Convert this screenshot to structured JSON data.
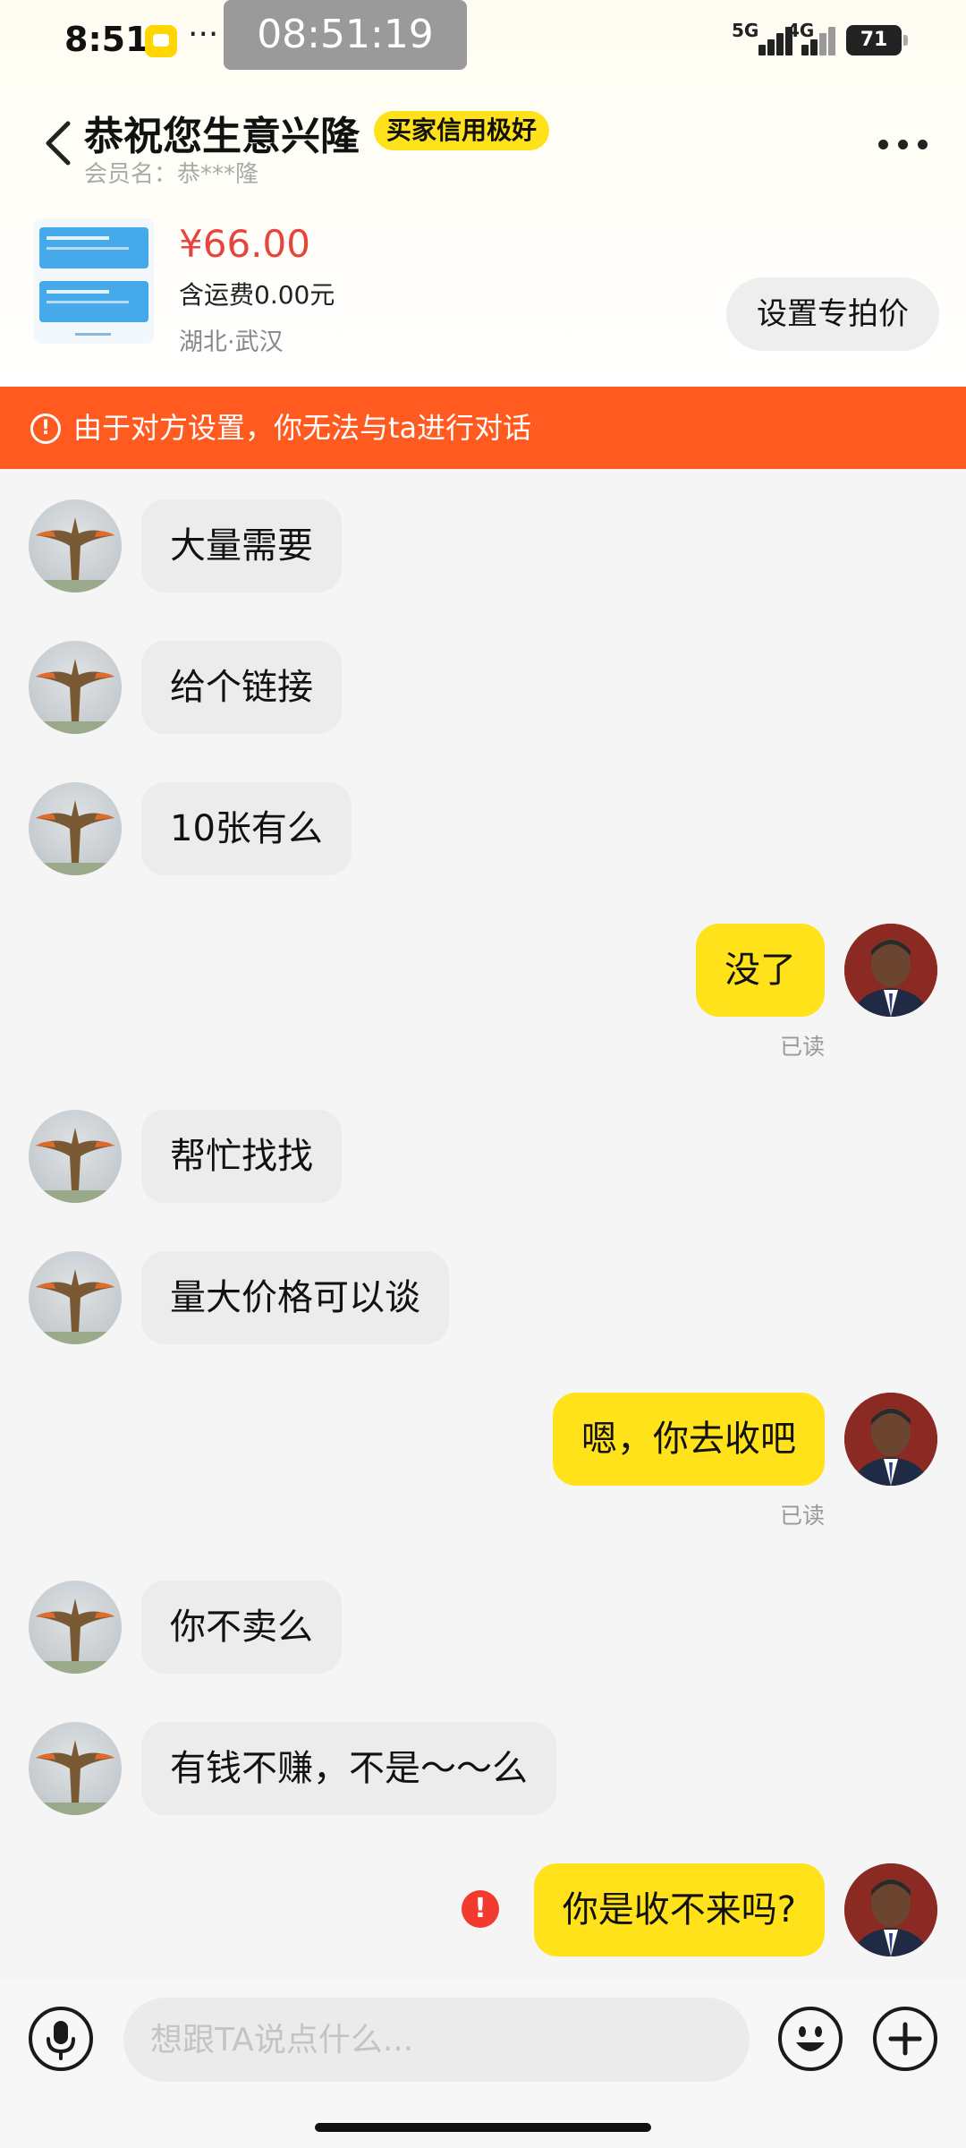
{
  "status_bar": {
    "time": "8:51",
    "dots": "···",
    "clock": "08:51:19",
    "net1": "5G",
    "net2": "4G",
    "battery": "71"
  },
  "header": {
    "title": "恭祝您生意兴隆",
    "badge": "买家信用极好",
    "member_name": "会员名：恭***隆"
  },
  "product": {
    "price": "¥66.00",
    "shipping": "含运费0.00元",
    "location": "湖北·武汉",
    "special_price_button": "设置专拍价"
  },
  "banner": {
    "warning_text": "由于对方设置，你无法与ta进行对话"
  },
  "messages": [
    {
      "from": "buyer",
      "text": "大量需要"
    },
    {
      "from": "buyer",
      "text": "给个链接"
    },
    {
      "from": "buyer",
      "text": "10张有么"
    },
    {
      "from": "me",
      "text": "没了",
      "status": "已读"
    },
    {
      "from": "buyer",
      "text": "帮忙找找"
    },
    {
      "from": "buyer",
      "text": "量大价格可以谈"
    },
    {
      "from": "me",
      "text": "嗯，你去收吧",
      "status": "已读"
    },
    {
      "from": "buyer",
      "text": "你不卖么"
    },
    {
      "from": "buyer",
      "text": "有钱不赚，不是～～么"
    },
    {
      "from": "me",
      "text": "你是收不来吗?",
      "failed": true
    }
  ],
  "input": {
    "placeholder": "想跟TA说点什么..."
  },
  "colors": {
    "accent_yellow": "#ffe21a",
    "warning_orange": "#ff5a1f",
    "price_red": "#e8443c",
    "error_red": "#f23b2e"
  },
  "icons": [
    "back-icon",
    "more-icon",
    "warning-icon",
    "error-icon",
    "microphone-icon",
    "emoji-icon",
    "plus-icon"
  ]
}
